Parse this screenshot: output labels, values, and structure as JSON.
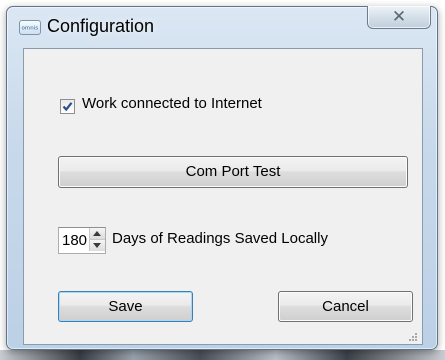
{
  "window": {
    "title": "Configuration",
    "app_icon": "omnis-logo-icon",
    "close_glyph": "✕"
  },
  "form": {
    "work_connected_checkbox": {
      "label": "Work connected to Internet",
      "checked": true
    },
    "com_port_test_button": "Com Port Test",
    "days_spinner": {
      "value": "180",
      "label": "Days of Readings Saved Locally"
    },
    "save_button": "Save",
    "cancel_button": "Cancel"
  }
}
